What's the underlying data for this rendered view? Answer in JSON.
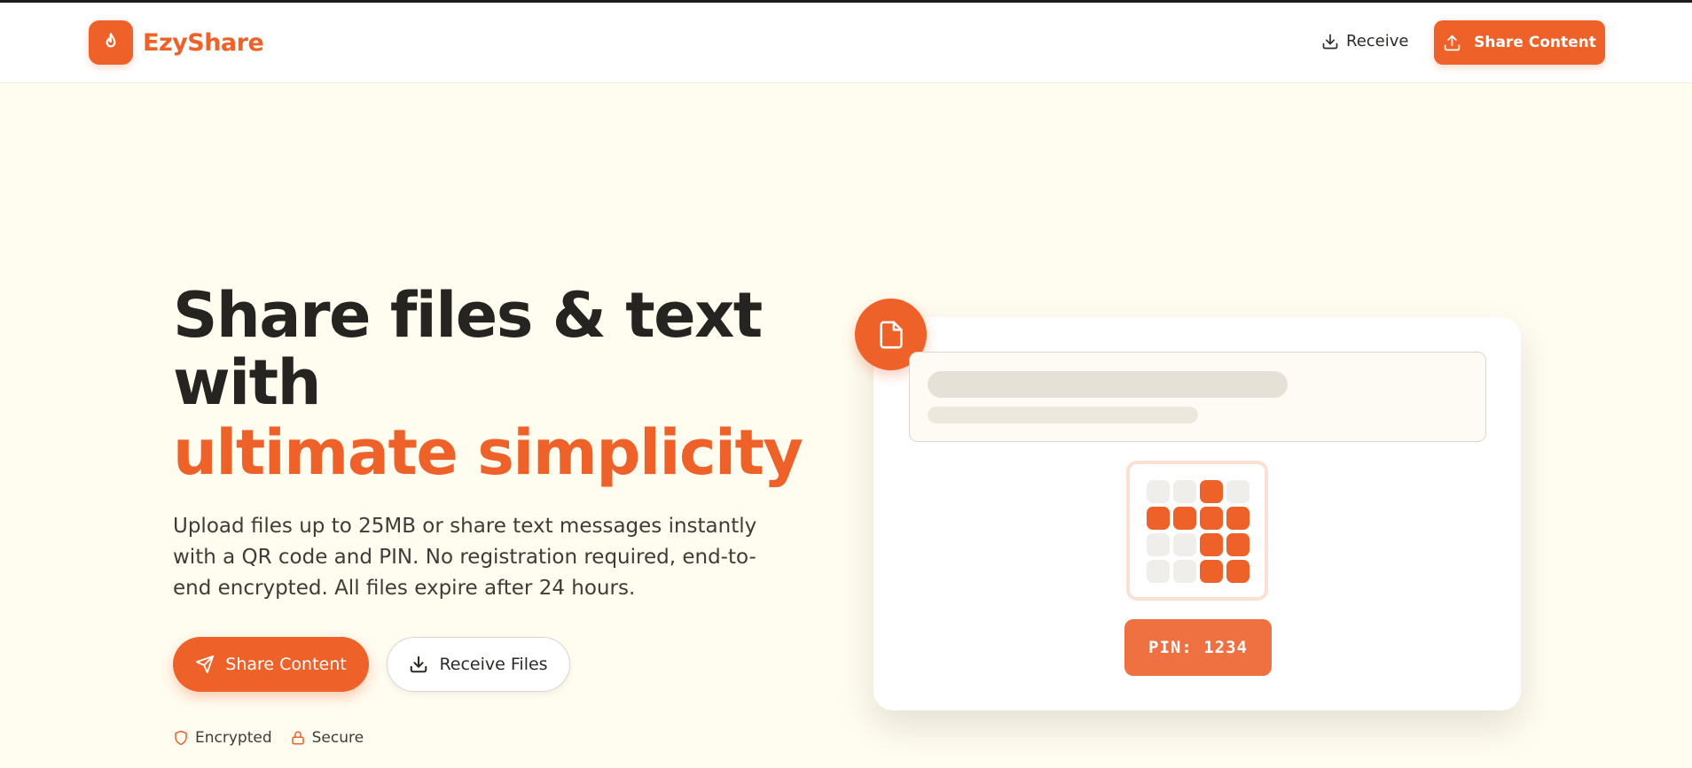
{
  "app": {
    "name": "EzyShare",
    "brand_color": "#ee6129"
  },
  "header": {
    "logo_icon": "flame-icon",
    "receive_label": "Receive",
    "receive_icon": "download-icon",
    "share_label": "Share Content",
    "share_icon": "upload-icon"
  },
  "hero": {
    "title_line1": "Share files & text",
    "title_line2": "with",
    "title_accent": "ultimate simplicity",
    "description": "Upload files up to 25MB or share text messages instantly with a QR code and PIN. No registration required, end-to-end encrypted. All files expire after 24 hours.",
    "primary_button": {
      "label": "Share Content",
      "icon": "send-icon"
    },
    "secondary_button": {
      "label": "Receive Files",
      "icon": "download-icon"
    },
    "badges": [
      {
        "label": "Encrypted",
        "icon": "shield-icon"
      },
      {
        "label": "Secure",
        "icon": "lock-icon"
      }
    ]
  },
  "preview_card": {
    "file_icon": "file-icon",
    "qr_pattern": [
      [
        0,
        0,
        1,
        0
      ],
      [
        1,
        1,
        1,
        1
      ],
      [
        0,
        0,
        1,
        1
      ],
      [
        0,
        0,
        1,
        1
      ]
    ],
    "pin_label": "PIN: 1234"
  }
}
